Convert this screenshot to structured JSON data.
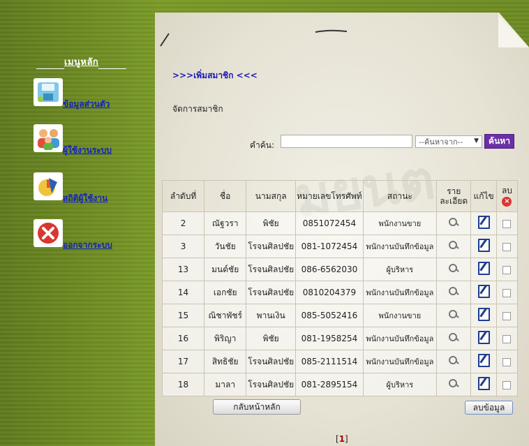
{
  "sidebar": {
    "menu_title": "เมนูหลัก",
    "items": [
      {
        "label": "ข้อมูลส่วนตัว",
        "icon": "floppy-disk-icon"
      },
      {
        "label": "ผู้ใช้งานระบบ",
        "icon": "users-icon"
      },
      {
        "label": "สถิติผู้ใช้งาน",
        "icon": "statistics-icon"
      },
      {
        "label": "ออกจากระบบ",
        "icon": "exit-icon"
      }
    ]
  },
  "main": {
    "heading": ">>>เพิ่มสมาชิก <<<",
    "subheading": "จัดการสมาชิก",
    "watermark": "มยนต",
    "search": {
      "label": "คำค้น:",
      "value": "",
      "select_value": "--ค้นหาจาก--",
      "button": "ค้นหา"
    },
    "table": {
      "headers": {
        "no": "ลำดับที่",
        "name": "ชื่อ",
        "surname": "นามสกุล",
        "phone": "หมายเลขโทรศัพท์",
        "status": "สถานะ",
        "detail": "รายละเอียด",
        "edit": "แก้ไข",
        "delete": "ลบ"
      },
      "rows": [
        {
          "no": "2",
          "name": "ณัฐวรา",
          "surname": "พิชัย",
          "phone": "0851072454",
          "status": "พนักงานขาย"
        },
        {
          "no": "3",
          "name": "วันชัย",
          "surname": "โรจนศิลปชัย",
          "phone": "081-1072454",
          "status": "พนักงานบันทึกข้อมูล"
        },
        {
          "no": "13",
          "name": "มนต์ชัย",
          "surname": "โรจนศิลปชัย",
          "phone": "086-6562030",
          "status": "ผู้บริหาร"
        },
        {
          "no": "14",
          "name": "เอกชัย",
          "surname": "โรจนศิลปชัย",
          "phone": "0810204379",
          "status": "พนักงานบันทึกข้อมูล"
        },
        {
          "no": "15",
          "name": "ณิชาพัชร์",
          "surname": "พานเงิน",
          "phone": "085-5052416",
          "status": "พนักงานขาย"
        },
        {
          "no": "16",
          "name": "พิริญา",
          "surname": "พิชัย",
          "phone": "081-1958254",
          "status": "พนักงานบันทึกข้อมูล"
        },
        {
          "no": "17",
          "name": "สิทธิชัย",
          "surname": "โรจนศิลปชัย",
          "phone": "085-2111514",
          "status": "พนักงานบันทึกข้อมูล"
        },
        {
          "no": "18",
          "name": "มาลา",
          "surname": "โรจนศิลปชัย",
          "phone": "081-2895154",
          "status": "ผู้บริหาร"
        }
      ]
    },
    "home_button": "กลับหน้าหลัก",
    "delete_button": "ลบข้อมูล",
    "pagination": {
      "current": "1"
    }
  },
  "colors": {
    "background": "#6c8a22",
    "link": "#1424b8",
    "search_button": "#6b2fa8"
  }
}
